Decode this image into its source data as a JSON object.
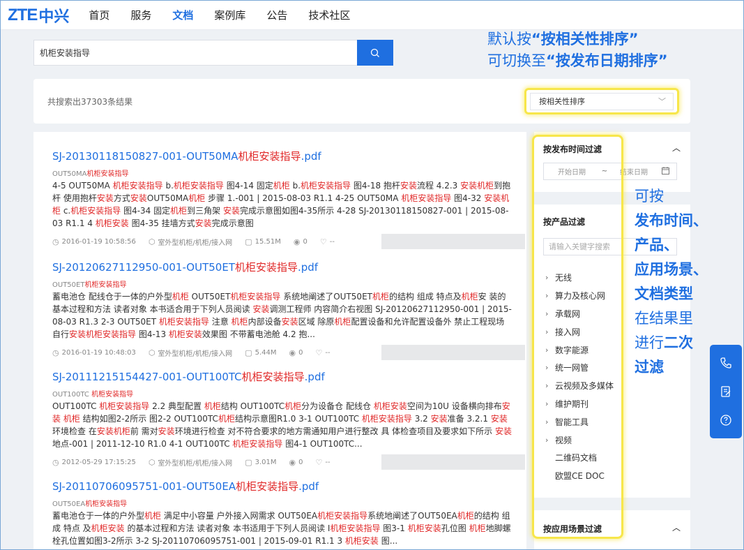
{
  "nav": {
    "logo_latin": "ZTE",
    "logo_cn": "中兴",
    "items": [
      "首页",
      "服务",
      "文档",
      "案例库",
      "公告",
      "技术社区"
    ],
    "active_index": 2
  },
  "search": {
    "value": "机柜安装指导"
  },
  "annotation_top": {
    "line1_prefix": "默认按",
    "line1_bold": "“按相关性排序”",
    "line2_prefix": "可切换至",
    "line2_bold": "“按发布日期排序”"
  },
  "results_count": "共搜索出37303条结果",
  "sort": {
    "selected": "按相关性排序"
  },
  "results": [
    {
      "title_prefix": "SJ-20130118150827-001-OUT50MA",
      "title_hl": "机柜安装指导",
      "title_suffix": ".pdf",
      "sub_prefix": "OUT50MA",
      "sub_hl": "机柜安装指导",
      "body": [
        {
          "t": "4-5 OUT50MA "
        },
        {
          "t": "机柜安装指导",
          "hl": true
        },
        {
          "t": " b."
        },
        {
          "t": "机柜安装指导",
          "hl": true
        },
        {
          "t": " 图4-14 固定"
        },
        {
          "t": "机柜",
          "hl": true
        },
        {
          "t": " b."
        },
        {
          "t": "机柜安装指导",
          "hl": true
        },
        {
          "t": " 图4-18 抱杆"
        },
        {
          "t": "安装",
          "hl": true
        },
        {
          "t": "流程 4.2.3 "
        },
        {
          "t": "安装机柜",
          "hl": true
        },
        {
          "t": "到抱杆 使用抱杆"
        },
        {
          "t": "安装",
          "hl": true
        },
        {
          "t": "方式"
        },
        {
          "t": "安装",
          "hl": true
        },
        {
          "t": "OUT50MA"
        },
        {
          "t": "机柜",
          "hl": true
        },
        {
          "t": " 步骤 1.-001 | 2015-08-03 R1.1 4-25 OUT50MA "
        },
        {
          "t": "机柜安装指导",
          "hl": true
        },
        {
          "t": " 图4-32 "
        },
        {
          "t": "安装机柜",
          "hl": true
        },
        {
          "t": " c."
        },
        {
          "t": "机柜安装指导",
          "hl": true
        },
        {
          "t": " 图4-34 固定"
        },
        {
          "t": "机柜",
          "hl": true
        },
        {
          "t": "到三角架 "
        },
        {
          "t": "安装",
          "hl": true
        },
        {
          "t": "完成示意图如图4-35所示 4-28 SJ-20130118150827-001 | 2015-08-03 R1.1 4 "
        },
        {
          "t": "机柜安装",
          "hl": true
        },
        {
          "t": " 图4-35 挂墙方式"
        },
        {
          "t": "安装",
          "hl": true
        },
        {
          "t": "完成示意图"
        }
      ],
      "meta": {
        "date": "2016-01-19 10:58:56",
        "category": "室外型机柜/机柜/接入网",
        "size": "15.51M",
        "views": "0",
        "extra": "--"
      }
    },
    {
      "title_prefix": "SJ-20120627112950-001-OUT50ET",
      "title_hl": "机柜安装指导",
      "title_suffix": ".pdf",
      "sub_prefix": "OUT50ET",
      "sub_hl": "机柜安装指导",
      "body": [
        {
          "t": "蓄电池仓 配线仓于一体的户外型"
        },
        {
          "t": "机柜",
          "hl": true
        },
        {
          "t": " OUT50ET"
        },
        {
          "t": "机柜安装指导",
          "hl": true
        },
        {
          "t": " 系统地阐述了OUT50ET"
        },
        {
          "t": "机柜",
          "hl": true
        },
        {
          "t": "的结构 组成 特点及"
        },
        {
          "t": "机柜",
          "hl": true
        },
        {
          "t": "安 装的基本过程和方法 读者对象 本书适合用于下列人员阅读 "
        },
        {
          "t": "安装",
          "hl": true
        },
        {
          "t": "调测工程师 内容简介右视图 SJ-20120627112950-001 | 2015-08-03 R1.3 2-3 OUT50ET "
        },
        {
          "t": "机柜安装指导",
          "hl": true
        },
        {
          "t": " 注意 "
        },
        {
          "t": "机柜",
          "hl": true
        },
        {
          "t": "内部设备"
        },
        {
          "t": "安装",
          "hl": true
        },
        {
          "t": "区域 除原"
        },
        {
          "t": "机柜",
          "hl": true
        },
        {
          "t": "配置设备和允许配置设备外 禁止工程现场自行"
        },
        {
          "t": "安装机柜安装指导",
          "hl": true
        },
        {
          "t": " 图4-13 "
        },
        {
          "t": "机柜安装",
          "hl": true
        },
        {
          "t": "效果图 不带蓄电池舱 4.2 抱..."
        }
      ],
      "meta": {
        "date": "2016-01-19 10:48:03",
        "category": "室外型机柜/机柜/接入网",
        "size": "5.44M",
        "views": "0",
        "extra": "--"
      }
    },
    {
      "title_prefix": "SJ-20111215154427-001-OUT100TC",
      "title_hl": "机柜安装指导",
      "title_suffix": ".pdf",
      "sub_prefix": "OUT100TC ",
      "sub_hl": "机柜安装指导",
      "body": [
        {
          "t": "OUT100TC "
        },
        {
          "t": "机柜安装指导",
          "hl": true
        },
        {
          "t": " 2.2 典型配置 "
        },
        {
          "t": "机柜",
          "hl": true
        },
        {
          "t": "结构 OUT100TC"
        },
        {
          "t": "机柜",
          "hl": true
        },
        {
          "t": "分为设备仓 配线仓 "
        },
        {
          "t": "机柜安装",
          "hl": true
        },
        {
          "t": "空间为10U 设备横向排布"
        },
        {
          "t": "安装 机柜",
          "hl": true
        },
        {
          "t": " 结构如图2-2所示 图2-2 OUT100TC"
        },
        {
          "t": "机柜",
          "hl": true
        },
        {
          "t": "结构示意图R1.0 3-1 OUT100TC "
        },
        {
          "t": "机柜安装指导",
          "hl": true
        },
        {
          "t": " 3.2 "
        },
        {
          "t": "安装",
          "hl": true
        },
        {
          "t": "准备 3.2.1 "
        },
        {
          "t": "安装",
          "hl": true
        },
        {
          "t": "环境检查 在"
        },
        {
          "t": "安装机柜",
          "hl": true
        },
        {
          "t": "前 需对"
        },
        {
          "t": "安装",
          "hl": true
        },
        {
          "t": "环境进行检查 对不符合要求的地方需通知用户进行整改 具 体检查项目及要求如下所示 "
        },
        {
          "t": "安装",
          "hl": true
        },
        {
          "t": "地点-001 | 2011-12-10 R1.0 4-1 OUT100TC "
        },
        {
          "t": "机柜安装指导",
          "hl": true
        },
        {
          "t": " 图4-1 OUT100TC..."
        }
      ],
      "meta": {
        "date": "2012-05-29 17:15:25",
        "category": "室外型机柜/机柜/接入网",
        "size": "3.01M",
        "views": "0",
        "extra": "--"
      }
    },
    {
      "title_prefix": "SJ-20110706095751-001-OUT50EA",
      "title_hl": "机柜安装指导",
      "title_suffix": ".pdf",
      "sub_prefix": "OUT50EA",
      "sub_hl": "机柜安装指导",
      "body": [
        {
          "t": "蓄电池仓于一体的户外型"
        },
        {
          "t": "机柜",
          "hl": true
        },
        {
          "t": " 满足中小容量 户外接入网需求 OUT50EA"
        },
        {
          "t": "机柜安装指导",
          "hl": true
        },
        {
          "t": "系统地阐述了OUT50EA"
        },
        {
          "t": "机柜",
          "hl": true
        },
        {
          "t": "的结构 组成 特点 及"
        },
        {
          "t": "机柜安装",
          "hl": true
        },
        {
          "t": " 的基本过程和方法 读者对象 本书适用于下列人员阅读 I"
        },
        {
          "t": "机柜安装指导",
          "hl": true
        },
        {
          "t": " 图3-1 "
        },
        {
          "t": "机柜安装",
          "hl": true
        },
        {
          "t": "孔位图 "
        },
        {
          "t": "机柜",
          "hl": true
        },
        {
          "t": "地脚螺栓孔位置如图3-2所示 3-2 SJ-20110706095751-001 | 2015-09-01 R1.1 3 "
        },
        {
          "t": "机柜安装",
          "hl": true
        },
        {
          "t": " 图..."
        }
      ],
      "meta": {
        "date": "",
        "category": "",
        "size": "",
        "views": "",
        "extra": ""
      }
    }
  ],
  "filters": {
    "date": {
      "title": "按发布时间过滤",
      "start_placeholder": "开始日期",
      "sep": "~",
      "end_placeholder": "结束日期"
    },
    "product": {
      "title": "按产品过滤",
      "keyword_placeholder": "请输入关键字搜索",
      "categories": [
        {
          "label": "无线",
          "arrow": true
        },
        {
          "label": "算力及核心网",
          "arrow": true
        },
        {
          "label": "承载网",
          "arrow": true
        },
        {
          "label": "接入网",
          "arrow": true
        },
        {
          "label": "数字能源",
          "arrow": true
        },
        {
          "label": "统一网管",
          "arrow": true
        },
        {
          "label": "云视频及多媒体",
          "arrow": true
        },
        {
          "label": "维护期刊",
          "arrow": true
        },
        {
          "label": "智能工具",
          "arrow": true
        },
        {
          "label": "视频",
          "arrow": true
        },
        {
          "label": "二维码文档",
          "arrow": false
        },
        {
          "label": "欧盟CE DOC",
          "arrow": false
        }
      ]
    },
    "scenario": {
      "title": "按应用场景过滤"
    }
  },
  "annotation_side": {
    "line1": "可按",
    "line2": "发布时间、",
    "line3": "产品、",
    "line4": "应用场景、",
    "line5": "文档类型",
    "line6": "在结果里",
    "line7_prefix": "进行",
    "line7_bold": "二次",
    "line8": "过滤"
  },
  "colors": {
    "brand": "#1f6fe0",
    "highlight_text": "#e02828",
    "annotation_border": "#f7e64a"
  },
  "icons": {
    "search": "search-icon",
    "clock": "clock-icon",
    "cube": "cube-icon",
    "file": "file-icon",
    "eye": "eye-icon",
    "like": "like-icon",
    "calendar": "calendar-icon",
    "caret_up": "caret-up-icon",
    "chevron_right": "chevron-right-icon",
    "phone": "phone-icon",
    "edit": "edit-icon",
    "help": "help-icon"
  }
}
